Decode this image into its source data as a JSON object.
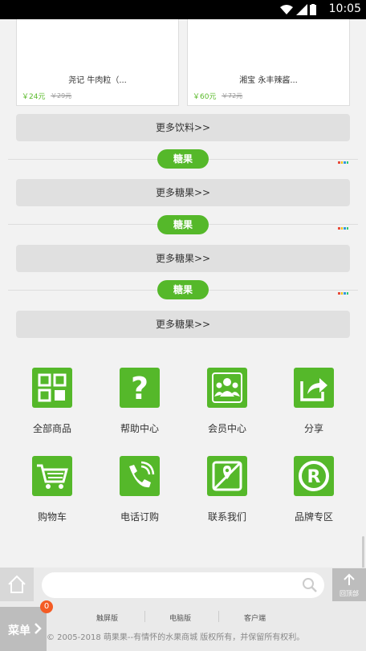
{
  "status_bar": {
    "time": "10:05"
  },
  "products": [
    {
      "name": "尧记 牛肉粒（...",
      "price": "￥24元",
      "old_price": "￥29元"
    },
    {
      "name": "湘宝 永丰辣酱...",
      "price": "￥60元",
      "old_price": "￥72元"
    }
  ],
  "more_buttons": [
    "更多饮料>>",
    "更多糖果>>",
    "更多糖果>>",
    "更多糖果>>"
  ],
  "sections": [
    "糖果",
    "糖果",
    "糖果"
  ],
  "grid": [
    {
      "label": "全部商品",
      "icon": "grid-icon"
    },
    {
      "label": "帮助中心",
      "icon": "help-icon"
    },
    {
      "label": "会员中心",
      "icon": "members-icon"
    },
    {
      "label": "分享",
      "icon": "share-icon"
    },
    {
      "label": "购物车",
      "icon": "cart-icon"
    },
    {
      "label": "电话订购",
      "icon": "phone-icon"
    },
    {
      "label": "联系我们",
      "icon": "map-icon"
    },
    {
      "label": "品牌专区",
      "icon": "registered-icon"
    }
  ],
  "bottom": {
    "search_placeholder": "",
    "top_label": "回顶部",
    "links": [
      "触屏版",
      "电脑版",
      "客户端"
    ],
    "copyright": "© 2005-2018 萌果果--有情怀的水果商城 版权所有，并保留所有权利。",
    "menu_label": "菜单",
    "badge_count": "0"
  },
  "colors": {
    "accent": "#55b82a",
    "badge": "#f45b24"
  }
}
